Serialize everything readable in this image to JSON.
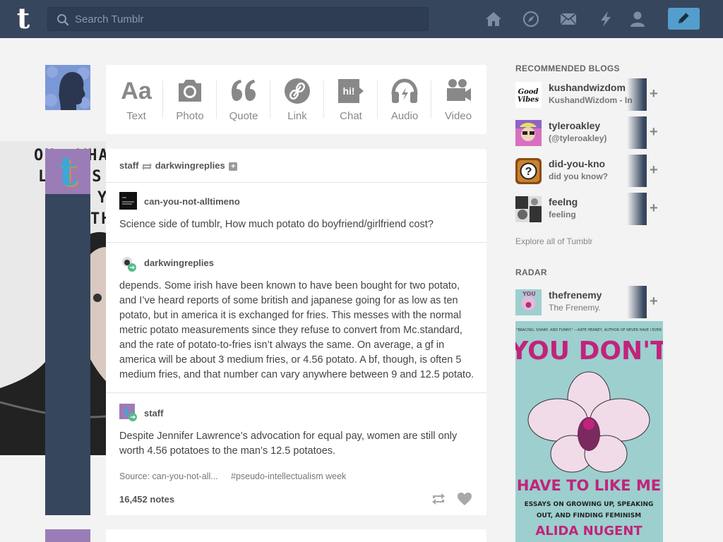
{
  "topbar": {
    "search_placeholder": "Search Tumblr",
    "nav_icons": [
      "home-icon",
      "explore-icon",
      "inbox-icon",
      "activity-icon",
      "account-icon"
    ],
    "compose_icon": "pencil-icon",
    "bg_color": "#36465d",
    "accent": "#529ecc"
  },
  "post_types": [
    {
      "label": "Text",
      "icon": "text-icon"
    },
    {
      "label": "Photo",
      "icon": "camera-icon"
    },
    {
      "label": "Quote",
      "icon": "quote-icon"
    },
    {
      "label": "Link",
      "icon": "link-icon"
    },
    {
      "label": "Chat",
      "icon": "chat-icon"
    },
    {
      "label": "Audio",
      "icon": "headphones-icon"
    },
    {
      "label": "Video",
      "icon": "video-camera-icon"
    }
  ],
  "post": {
    "reblogger": "staff",
    "reblogged_from": "darkwingreplies",
    "entries": [
      {
        "user": "can-you-not-alltimeno",
        "text": "Science side of tumblr, How much potato do boyfriend/girlfriend cost?"
      },
      {
        "user": "darkwingreplies",
        "lines": [
          "depends. Some irish have been known to have been bought for two potato,",
          "and I’ve heard reports of some british and japanese going for as low as ten",
          "potato, but in america it is exchanged for fries. This messes with the normal",
          "metric potato measurements since they refuse to convert from Mc.standard,",
          "and the rate of potato-to-fries isn’t always the same. On average, a gf in",
          "america will be about 3 medium fries, or 4.56 potato. A bf, though, is often 5",
          "medium fries, and that number can vary anywhere between 9 and 12.5 potato."
        ]
      },
      {
        "user": "staff",
        "lines": [
          "Despite Jennifer Lawrence’s advocation for equal pay, women are still only",
          "worth 4.56 potatoes to the man’s 12.5 potatoes."
        ]
      }
    ],
    "source": "Source: can-you-not-all...",
    "tag": "#pseudo-intellectualism week",
    "notes": "16,452 notes"
  },
  "background_text": [
    "OH, WHAT CAN I SAY",
    "LADIES",
    "YOU",
    "THE"
  ],
  "sidebar": {
    "recommended_title": "RECOMMENDED BLOGS",
    "recommended": [
      {
        "name": "kushandwizdom",
        "title": "KushandWizdom - In"
      },
      {
        "name": "tyleroakley",
        "title": "(@tyleroakley)"
      },
      {
        "name": "did-you-kno",
        "title": "did you know?"
      },
      {
        "name": "feelng",
        "title": "feeling"
      }
    ],
    "explore": "Explore all of Tumblr",
    "radar_title": "RADAR",
    "radar": {
      "name": "thefrenemy",
      "title": "The Frenemy."
    },
    "radar_book": {
      "blurb": "\"BRACING, SHARP, AND FUNNY.\" —KATE HEANEY, AUTHOR OF NEVER HAVE I EVER",
      "title_line1": "YOU DON'T",
      "title_line2": "HAVE TO LIKE ME",
      "subtitle_line1": "ESSAYS ON GROWING UP, SPEAKING",
      "subtitle_line2": "OUT, AND FINDING FEMINISM",
      "author": "ALIDA NUGENT"
    }
  }
}
